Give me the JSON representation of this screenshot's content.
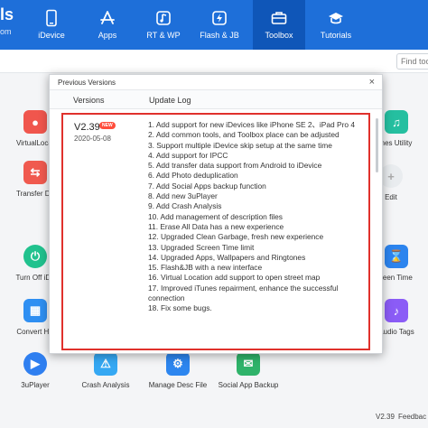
{
  "header": {
    "brand_line1": "ls",
    "brand_line2": "om",
    "nav": [
      {
        "label": "iDevice",
        "icon": "phone-icon"
      },
      {
        "label": "Apps",
        "icon": "app-store-icon"
      },
      {
        "label": "RT & WP",
        "icon": "ringtone-icon"
      },
      {
        "label": "Flash & JB",
        "icon": "flash-icon"
      },
      {
        "label": "Toolbox",
        "icon": "toolbox-icon"
      },
      {
        "label": "Tutorials",
        "icon": "graduation-cap-icon"
      }
    ],
    "active_tab": "Toolbox"
  },
  "search": {
    "placeholder": "Find too"
  },
  "tools": {
    "virtual_location": "VirtualLocat",
    "transfer_data": "Transfer Da",
    "itunes_utility": "nes Utility",
    "edit": "Edit",
    "turn_off_idevice": "Turn Off iDe",
    "screen_time": "reen Time",
    "convert_heic": "Convert HE",
    "audio_tags": "Audio Tags",
    "player": "3uPlayer",
    "crash_analysis": "Crash Analysis",
    "manage_desc_file": "Manage Desc File",
    "social_app_backup": "Social App Backup"
  },
  "footer": {
    "version": "V2.39",
    "feedback": "Feedbac"
  },
  "modal": {
    "title": "Previous Versions",
    "close": "×",
    "col_versions": "Versions",
    "col_log": "Update Log",
    "version": "V2.39",
    "badge": "NEW",
    "date": "2020-05-08",
    "log": [
      "1. Add support for new iDevices like iPhone SE 2、iPad Pro 4",
      "2. Add common tools, and Toolbox place can be adjusted",
      "3. Support multiple iDevice skip setup at the same time",
      "4. Add support for IPCC",
      "5. Add transfer data support from Android to iDevice",
      "6. Add Photo deduplication",
      "7. Add Social Apps backup function",
      "8. Add new 3uPlayer",
      "9. Add Crash Analysis",
      "10. Add management of description files",
      "11. Erase All Data has a new experience",
      "12. Upgraded Clean Garbage, fresh new experience",
      "13. Upgraded Screen Time limit",
      "14. Upgraded Apps, Wallpapers and Ringtones",
      "15. Flash&JB with a new interface",
      "16. Virtual Location add support to open street map",
      "17. Improved iTunes repairment, enhance the successful connection",
      "18. Fix some bugs."
    ]
  },
  "colors": {
    "header": "#1e6fd9",
    "active": "#0f56b8",
    "highlight_box": "#e0312c"
  }
}
